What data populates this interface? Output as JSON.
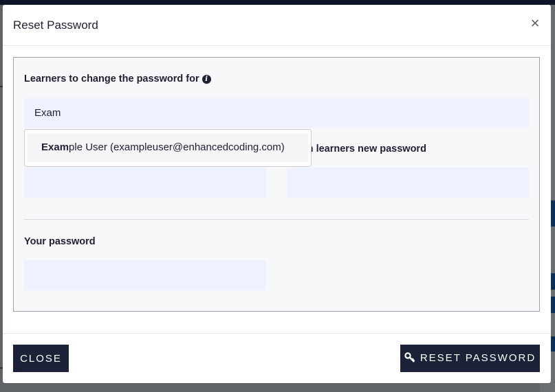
{
  "modal": {
    "title": "Reset Password",
    "close_symbol": "×"
  },
  "form": {
    "learners_label": "Learners to change the password for",
    "learners_info_icon": "info-circle-icon",
    "learners_value": "Exam",
    "new_password_label": "",
    "confirm_password_label": "rm learners new password",
    "your_password_label": "Your password"
  },
  "autocomplete": {
    "match": "Exam",
    "rest": "ple User (exampleuser@enhancedcoding.com)"
  },
  "footer": {
    "close_label": "CLOSE",
    "reset_label": "RESET PASSWORD",
    "reset_icon": "key-icon"
  },
  "colors": {
    "primary_button": "#1b2238",
    "input_bg": "#eef2fe",
    "overlay": "#5f6368"
  }
}
